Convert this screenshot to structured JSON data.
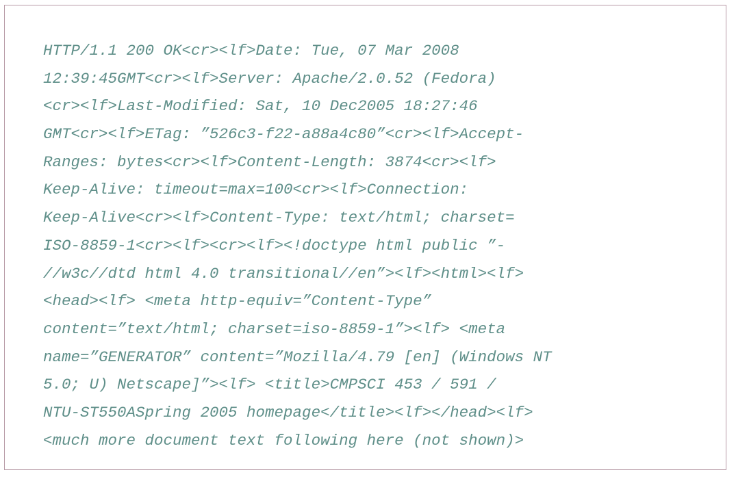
{
  "document": {
    "lines": [
      "HTTP/1.1 200 OK<cr><lf>Date: Tue, 07 Mar 2008",
      "12:39:45GMT<cr><lf>Server: Apache/2.0.52 (Fedora)",
      "<cr><lf>Last-Modified: Sat, 10 Dec2005 18:27:46",
      "GMT<cr><lf>ETag: ”526c3-f22-a88a4c80”<cr><lf>Accept-",
      "Ranges: bytes<cr><lf>Content-Length: 3874<cr><lf>",
      "Keep-Alive: timeout=max=100<cr><lf>Connection:",
      "Keep-Alive<cr><lf>Content-Type: text/html; charset=",
      "ISO-8859-1<cr><lf><cr><lf><!doctype html public ”-",
      "//w3c//dtd html 4.0 transitional//en”><lf><html><lf>",
      "<head><lf> <meta http-equiv=”Content-Type”",
      "content=”text/html; charset=iso-8859-1”><lf> <meta",
      "name=”GENERATOR” content=”Mozilla/4.79 [en] (Windows NT",
      "5.0; U) Netscape]”><lf> <title>CMPSCI 453 / 591 /",
      "NTU-ST550ASpring 2005 homepage</title><lf></head><lf>",
      "<much more document text following here (not shown)>"
    ],
    "colors": {
      "text": "#5f8f89",
      "border": "#b79aa6",
      "background": "#ffffff"
    }
  }
}
